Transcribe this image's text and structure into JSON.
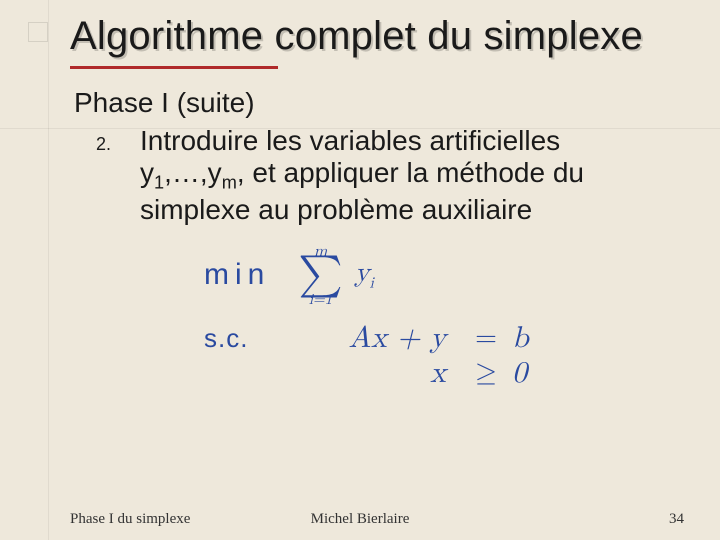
{
  "title": "Algorithme complet du simplexe",
  "subtitle": "Phase I (suite)",
  "item": {
    "number": "2.",
    "text_parts": {
      "p1": "Introduire les variables artificielles y",
      "s1": "1",
      "p2": ",…,y",
      "s2": "m",
      "p3": ", et appliquer la méthode du simplexe au problème auxiliaire"
    }
  },
  "math": {
    "min": "min",
    "sum_top": "m",
    "sum_bottom": "i=1",
    "summand_base": "y",
    "summand_sub": "i",
    "sc_label": "s.c.",
    "row1_lhs": "Ax + y",
    "row1_rel": "=",
    "row1_rhs": "b",
    "row2_lhs": "x",
    "row2_rel": "≥",
    "row2_rhs": "0"
  },
  "footer": {
    "left": "Phase I du simplexe",
    "center": "Michel Bierlaire",
    "right": "34"
  }
}
